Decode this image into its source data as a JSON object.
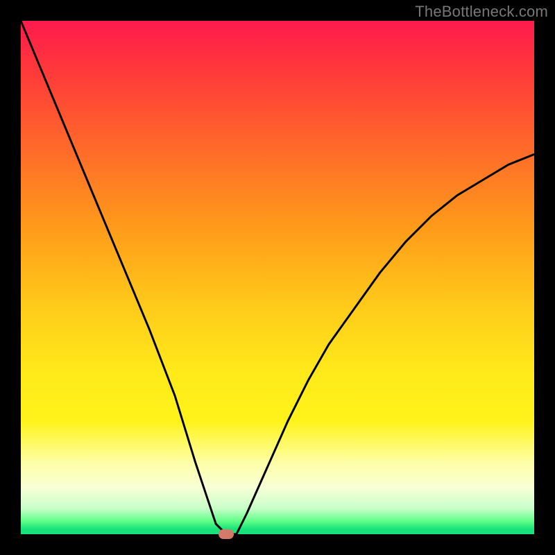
{
  "watermark": "TheBottleneck.com",
  "colors": {
    "background": "#000000",
    "gradient_top": "#ff1a4d",
    "gradient_bottom": "#18e27a",
    "curve": "#000000",
    "marker": "#d37a6a"
  },
  "chart_data": {
    "type": "line",
    "title": "",
    "xlabel": "",
    "ylabel": "",
    "xlim": [
      0,
      100
    ],
    "ylim": [
      0,
      100
    ],
    "annotations": [
      {
        "text": "TheBottleneck.com",
        "position": "top-right"
      }
    ],
    "marker": {
      "x": 40,
      "y": 0
    },
    "series": [
      {
        "name": "bottleneck-curve",
        "x": [
          0,
          5,
          10,
          15,
          20,
          25,
          30,
          34,
          36,
          38,
          40,
          42,
          44,
          48,
          52,
          56,
          60,
          65,
          70,
          75,
          80,
          85,
          90,
          95,
          100
        ],
        "y": [
          100,
          88,
          76,
          64,
          52,
          40,
          27,
          14,
          8,
          2,
          0,
          0,
          4,
          13,
          22,
          30,
          37,
          44,
          51,
          57,
          62,
          66,
          69,
          72,
          74
        ]
      }
    ]
  }
}
